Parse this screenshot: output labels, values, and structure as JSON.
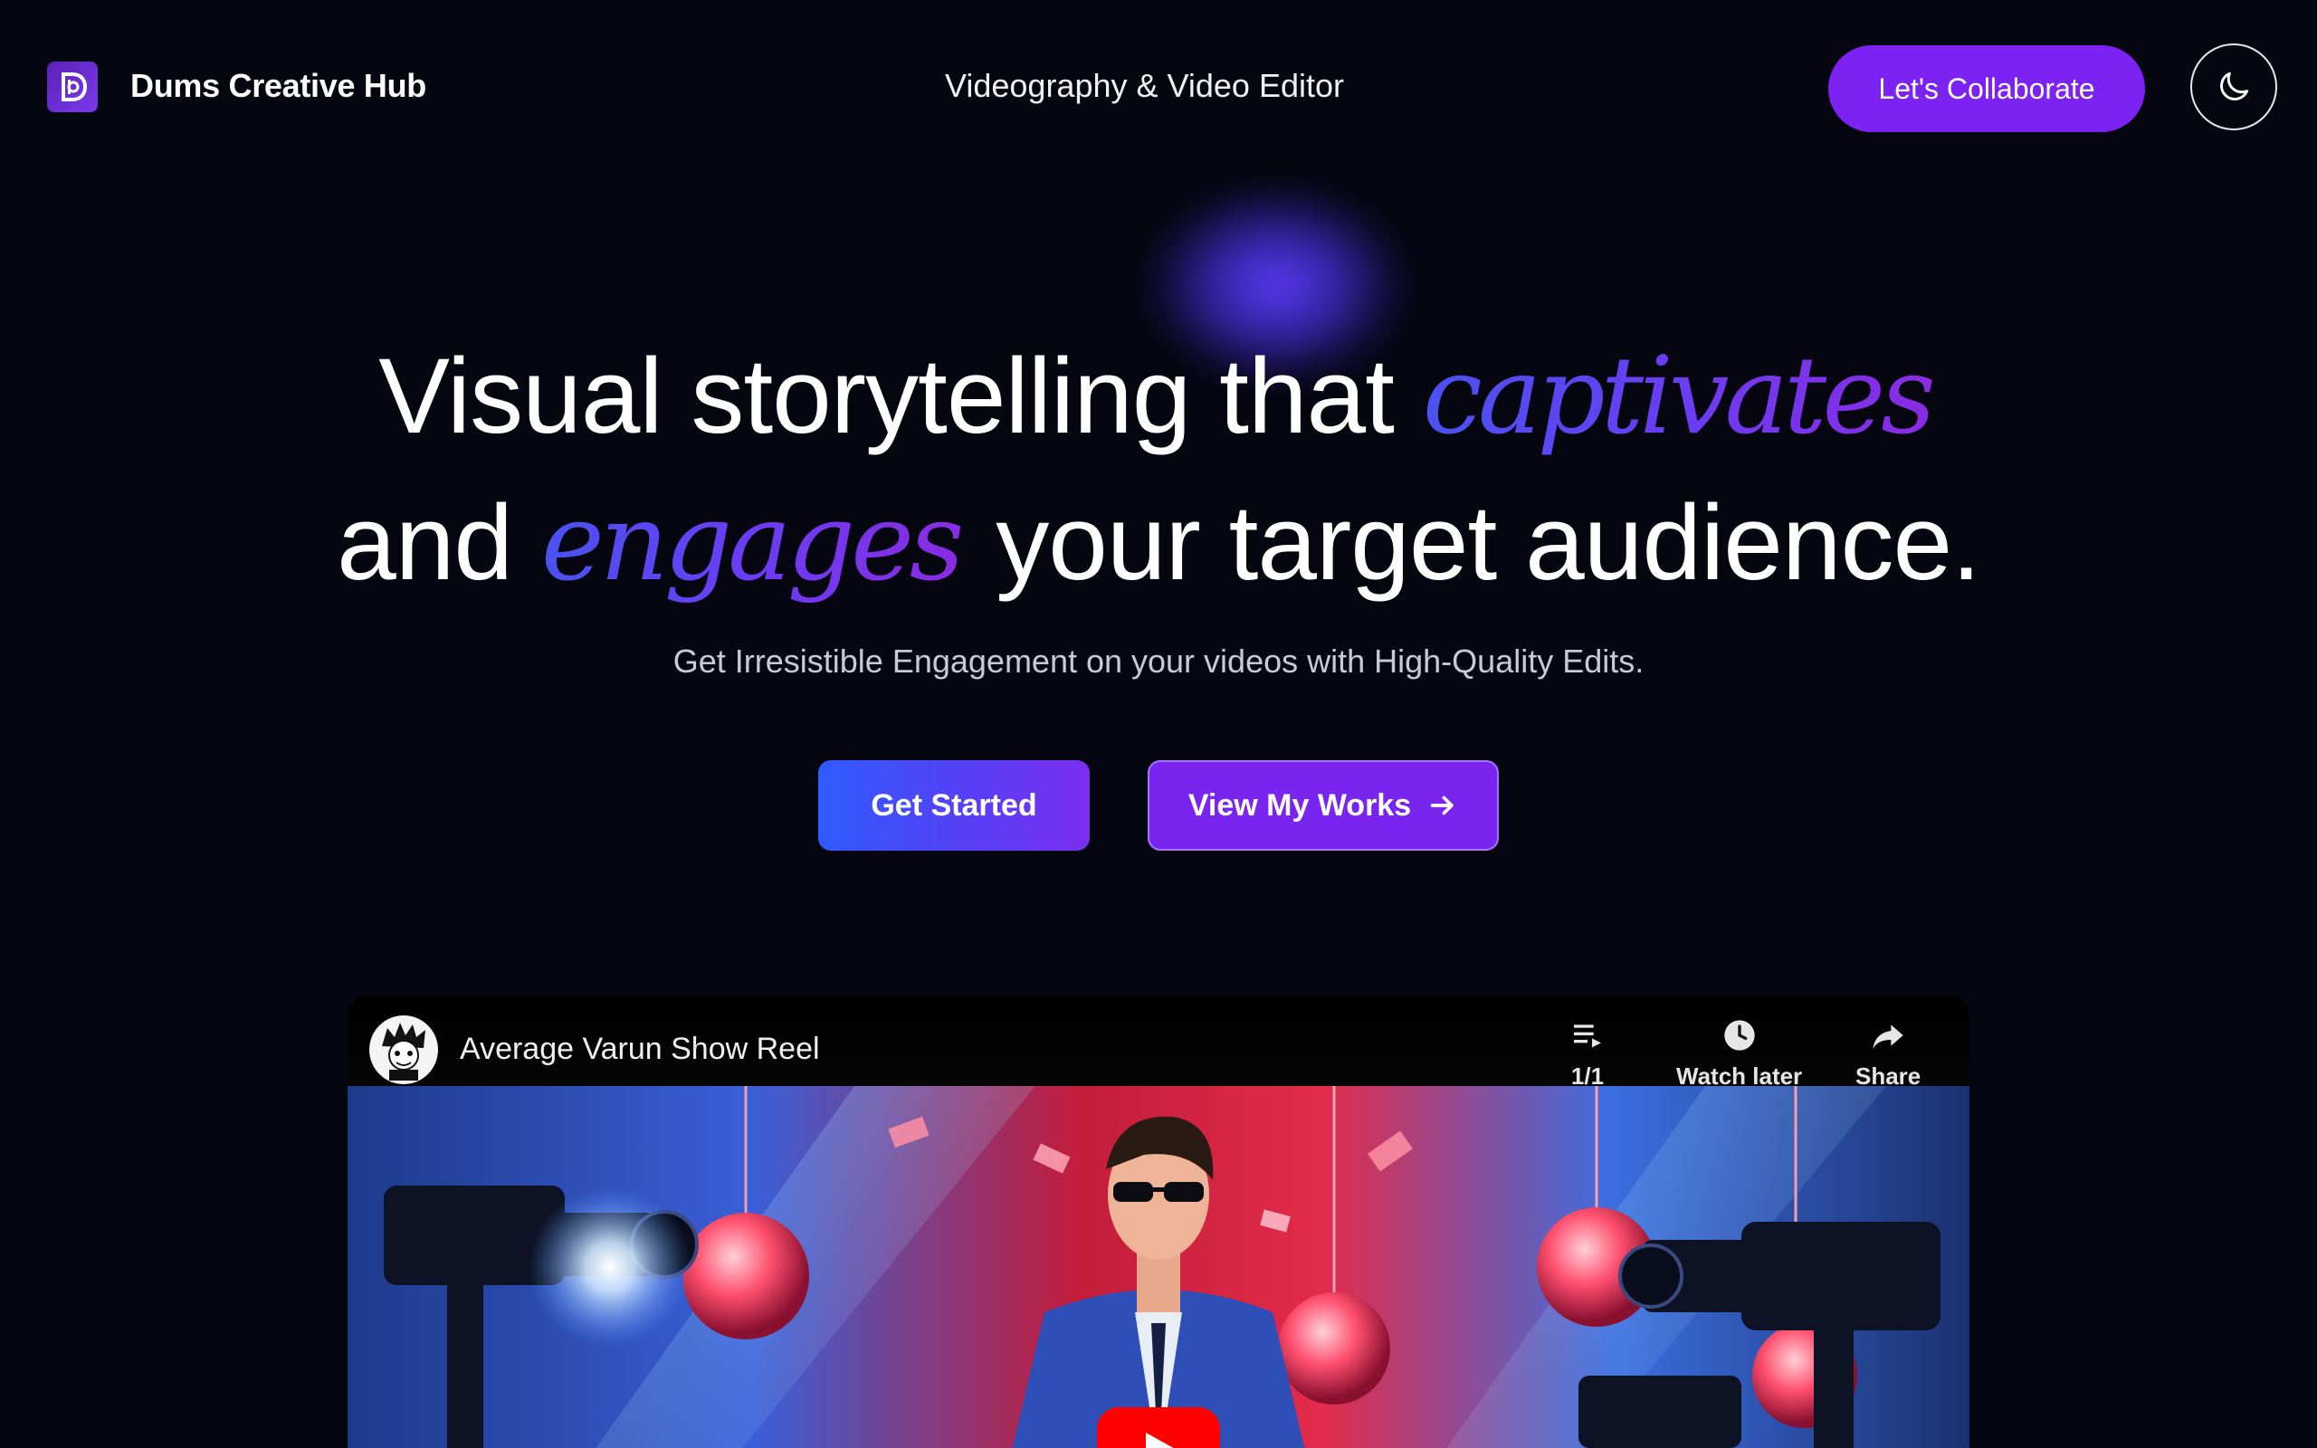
{
  "header": {
    "brand": "Dums Creative Hub",
    "logo_letter": "D",
    "tagline": "Videography & Video Editor",
    "collab_label": "Let's Collaborate",
    "theme_icon": "moon-icon"
  },
  "hero": {
    "line1_before": "Visual storytelling that ",
    "line1_accent": "captivates",
    "line2_before": "and ",
    "line2_accent": "engages",
    "line2_after": " your target audience.",
    "subtitle": "Get Irresistible Engagement on your videos with High-Quality Edits.",
    "get_started_label": "Get Started",
    "view_works_label": "View My Works"
  },
  "video": {
    "title": "Average Varun Show Reel",
    "playlist_count": "1/1",
    "watch_later_label": "Watch later",
    "share_label": "Share"
  },
  "colors": {
    "background": "#05060f",
    "accent_purple": "#7c22f2",
    "accent_blue": "#4a52f0",
    "youtube_red": "#ff0000"
  }
}
